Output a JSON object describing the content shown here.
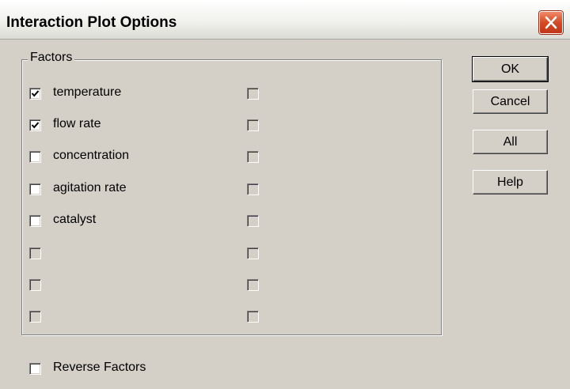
{
  "window": {
    "title": "Interaction Plot Options"
  },
  "factors_group": {
    "label": "Factors",
    "left_column": [
      {
        "label": "temperature",
        "checked": true,
        "enabled": true
      },
      {
        "label": "flow rate",
        "checked": true,
        "enabled": true
      },
      {
        "label": "concentration",
        "checked": false,
        "enabled": true
      },
      {
        "label": "agitation rate",
        "checked": false,
        "enabled": true
      },
      {
        "label": "catalyst",
        "checked": false,
        "enabled": true
      },
      {
        "label": "",
        "checked": false,
        "enabled": false
      },
      {
        "label": "",
        "checked": false,
        "enabled": false
      },
      {
        "label": "",
        "checked": false,
        "enabled": false
      }
    ],
    "right_column": [
      {
        "label": "",
        "checked": false,
        "enabled": false
      },
      {
        "label": "",
        "checked": false,
        "enabled": false
      },
      {
        "label": "",
        "checked": false,
        "enabled": false
      },
      {
        "label": "",
        "checked": false,
        "enabled": false
      },
      {
        "label": "",
        "checked": false,
        "enabled": false
      },
      {
        "label": "",
        "checked": false,
        "enabled": false
      },
      {
        "label": "",
        "checked": false,
        "enabled": false
      },
      {
        "label": "",
        "checked": false,
        "enabled": false
      }
    ]
  },
  "buttons": {
    "ok": "OK",
    "cancel": "Cancel",
    "all": "All",
    "help": "Help"
  },
  "reverse_factors": {
    "label": "Reverse Factors",
    "checked": false
  }
}
